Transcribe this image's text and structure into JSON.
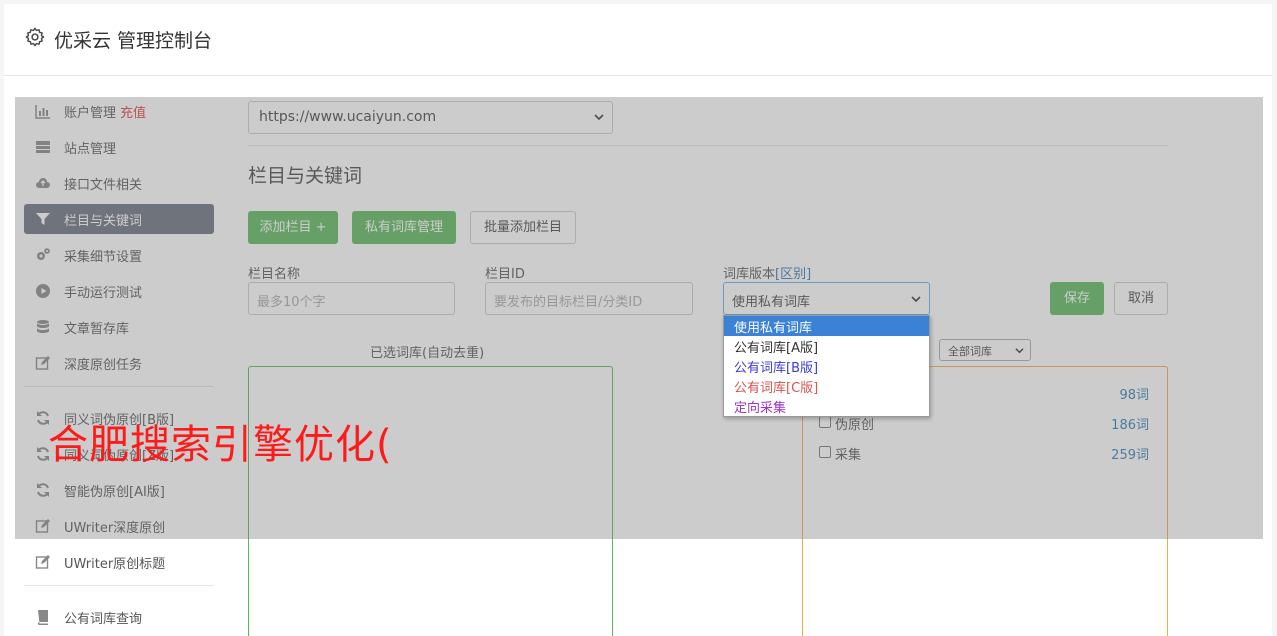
{
  "header": {
    "title": "优采云 管理控制台"
  },
  "sidebar": {
    "items": [
      {
        "label": "账户管理",
        "extra": "充值",
        "icon": "bar-chart-icon"
      },
      {
        "label": "站点管理",
        "icon": "server-icon"
      },
      {
        "label": "接口文件相关",
        "icon": "cloud-upload-icon"
      },
      {
        "label": "栏目与关键词",
        "icon": "filter-icon",
        "active": true
      },
      {
        "label": "采集细节设置",
        "icon": "gears-icon"
      },
      {
        "label": "手动运行测试",
        "icon": "play-circle-icon"
      },
      {
        "label": "文章暂存库",
        "icon": "database-icon"
      },
      {
        "label": "深度原创任务",
        "icon": "edit-icon"
      },
      {
        "label": "同义词伪原创[B版]",
        "icon": "refresh-icon"
      },
      {
        "label": "同义词伪原创[Z版]",
        "icon": "refresh-icon"
      },
      {
        "label": "智能伪原创[AI版]",
        "icon": "refresh-icon"
      },
      {
        "label": "UWriter深度原创",
        "icon": "edit-icon"
      },
      {
        "label": "UWriter原创标题",
        "icon": "edit-icon"
      },
      {
        "label": "公有词库查询",
        "icon": "book-icon"
      }
    ]
  },
  "main": {
    "site_select": "https://www.ucaiyun.com",
    "section_title": "栏目与关键词",
    "buttons": {
      "add_column": "添加栏目 +",
      "private_lib": "私有词库管理",
      "batch_add": "批量添加栏目",
      "save": "保存",
      "cancel": "取消"
    },
    "form": {
      "column_name_label": "栏目名称",
      "column_name_placeholder": "最多10个字",
      "column_id_label": "栏目ID",
      "column_id_placeholder": "要发布的目标栏目/分类ID",
      "lib_version_label": "词库版本",
      "lib_version_link": "[区别]",
      "lib_version_value": "使用私有词库"
    },
    "selected_panel_title": "已选词库(自动去重)",
    "filter_select": "全部词库",
    "libraries": [
      {
        "name": "",
        "count": "98词"
      },
      {
        "name": "伪原创",
        "count": "186词"
      },
      {
        "name": "采集",
        "count": "259词"
      }
    ]
  },
  "dropdown": {
    "options": [
      {
        "label": "使用私有词库",
        "color": "#ffffff",
        "selected": true
      },
      {
        "label": "公有词库[A版]",
        "color": "#333333"
      },
      {
        "label": "公有词库[B版]",
        "color": "#3b3bd6"
      },
      {
        "label": "公有词库[C版]",
        "color": "#d9534f"
      },
      {
        "label": "定向采集",
        "color": "#9933cc"
      }
    ]
  },
  "watermark": "合肥搜索引擎优化("
}
